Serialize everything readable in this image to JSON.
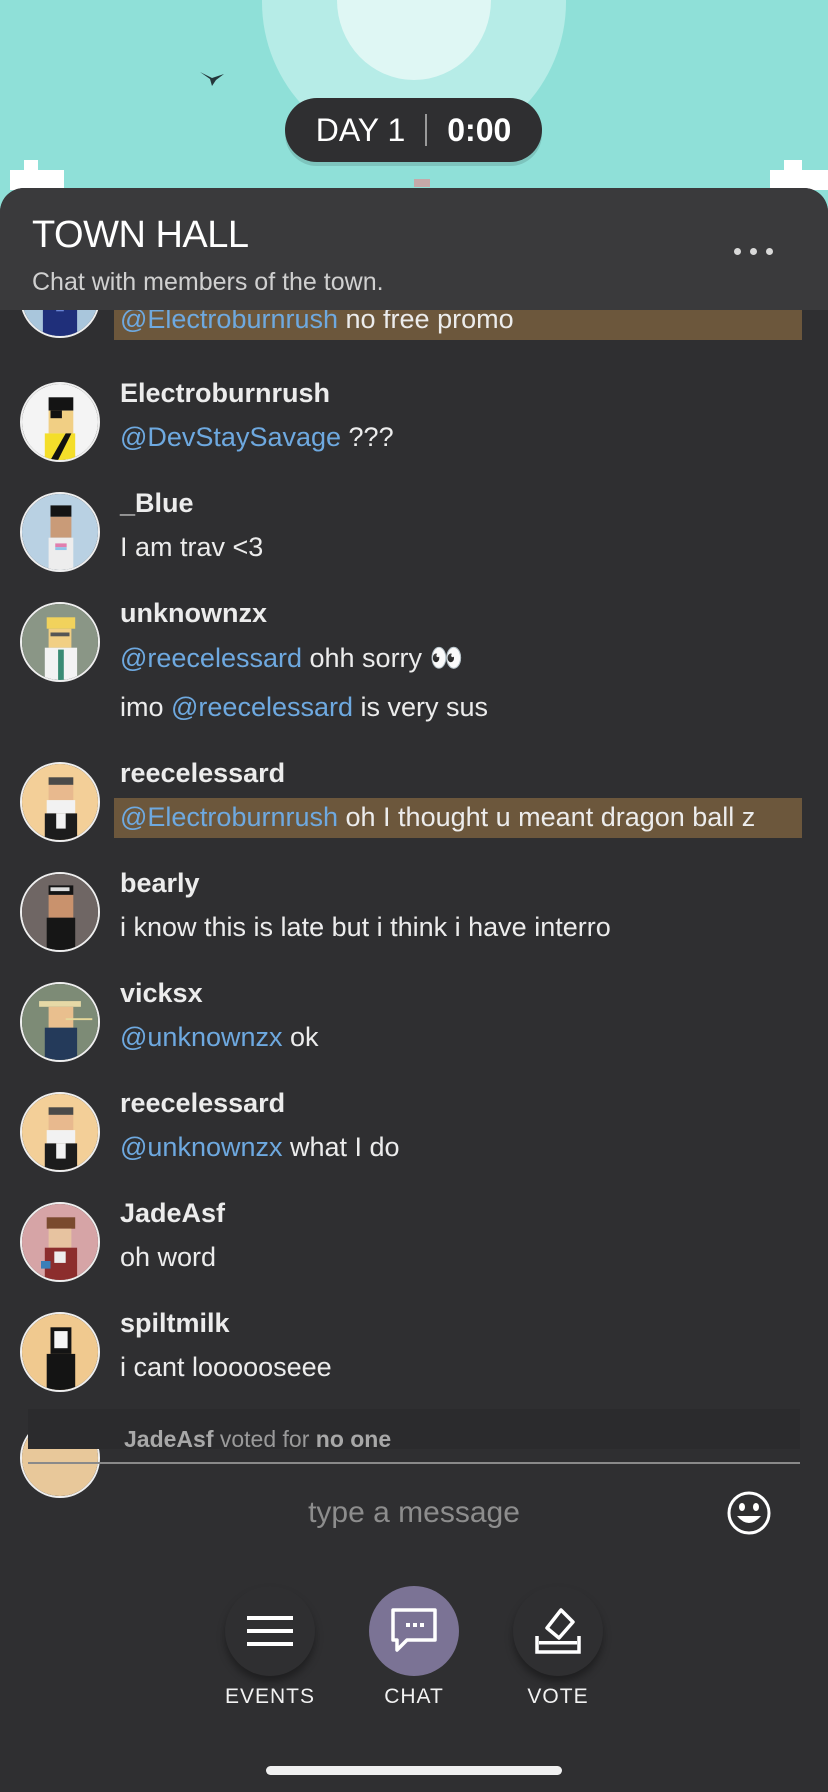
{
  "day_pill": {
    "day": "DAY 1",
    "time": "0:00"
  },
  "header": {
    "title": "TOWN HALL",
    "subtitle": "Chat with members of the town.",
    "more_icon": "more-dots-icon"
  },
  "messages": [
    {
      "user": "",
      "lines": [
        {
          "mention": "@Electroburnrush",
          "text": " no free promo"
        }
      ],
      "highlight": true
    },
    {
      "user": "Electroburnrush",
      "lines": [
        {
          "mention": "@DevStaySavage",
          "text": " ???"
        }
      ],
      "highlight": false
    },
    {
      "user": "_Blue",
      "lines": [
        {
          "mention": "",
          "text": "I am trav <3"
        }
      ],
      "highlight": false
    },
    {
      "user": "unknownzx",
      "lines": [
        {
          "mention": "@reecelessard",
          "text": " ohh sorry 👀"
        },
        {
          "prefix": "imo ",
          "mention": "@reecelessard",
          "text": " is very sus"
        }
      ],
      "highlight": false
    },
    {
      "user": "reecelessard",
      "lines": [
        {
          "mention": "@Electroburnrush",
          "text": " oh I thought u meant dragon ball z"
        }
      ],
      "highlight": true
    },
    {
      "user": "bearly",
      "lines": [
        {
          "mention": "",
          "text": "i know this is late but i think i have interro"
        }
      ],
      "highlight": false
    },
    {
      "user": "vicksx",
      "lines": [
        {
          "mention": "@unknownzx",
          "text": " ok"
        }
      ],
      "highlight": false
    },
    {
      "user": "reecelessard",
      "lines": [
        {
          "mention": "@unknownzx",
          "text": " what I do"
        }
      ],
      "highlight": false
    },
    {
      "user": "JadeAsf",
      "lines": [
        {
          "mention": "",
          "text": "oh word"
        }
      ],
      "highlight": false
    },
    {
      "user": "spiltmilk",
      "lines": [
        {
          "mention": "",
          "text": "i cant loooooseee"
        }
      ],
      "highlight": false
    }
  ],
  "vote_notice": {
    "user": "JadeAsf",
    "text": " voted for ",
    "target": "no one"
  },
  "composer": {
    "placeholder": "type a message",
    "emoji_icon": "smiley-icon"
  },
  "nav": [
    {
      "label": "EVENTS",
      "icon": "menu-lines-icon",
      "active": false
    },
    {
      "label": "CHAT",
      "icon": "chat-bubble-icon",
      "active": true
    },
    {
      "label": "VOTE",
      "icon": "ballot-box-icon",
      "active": false
    }
  ],
  "colors": {
    "mention": "#6ea9e0",
    "highlight": "#6c573c",
    "panel": "#2f2f31",
    "sky": "#8fe0d8",
    "active_nav": "#7b7395"
  }
}
